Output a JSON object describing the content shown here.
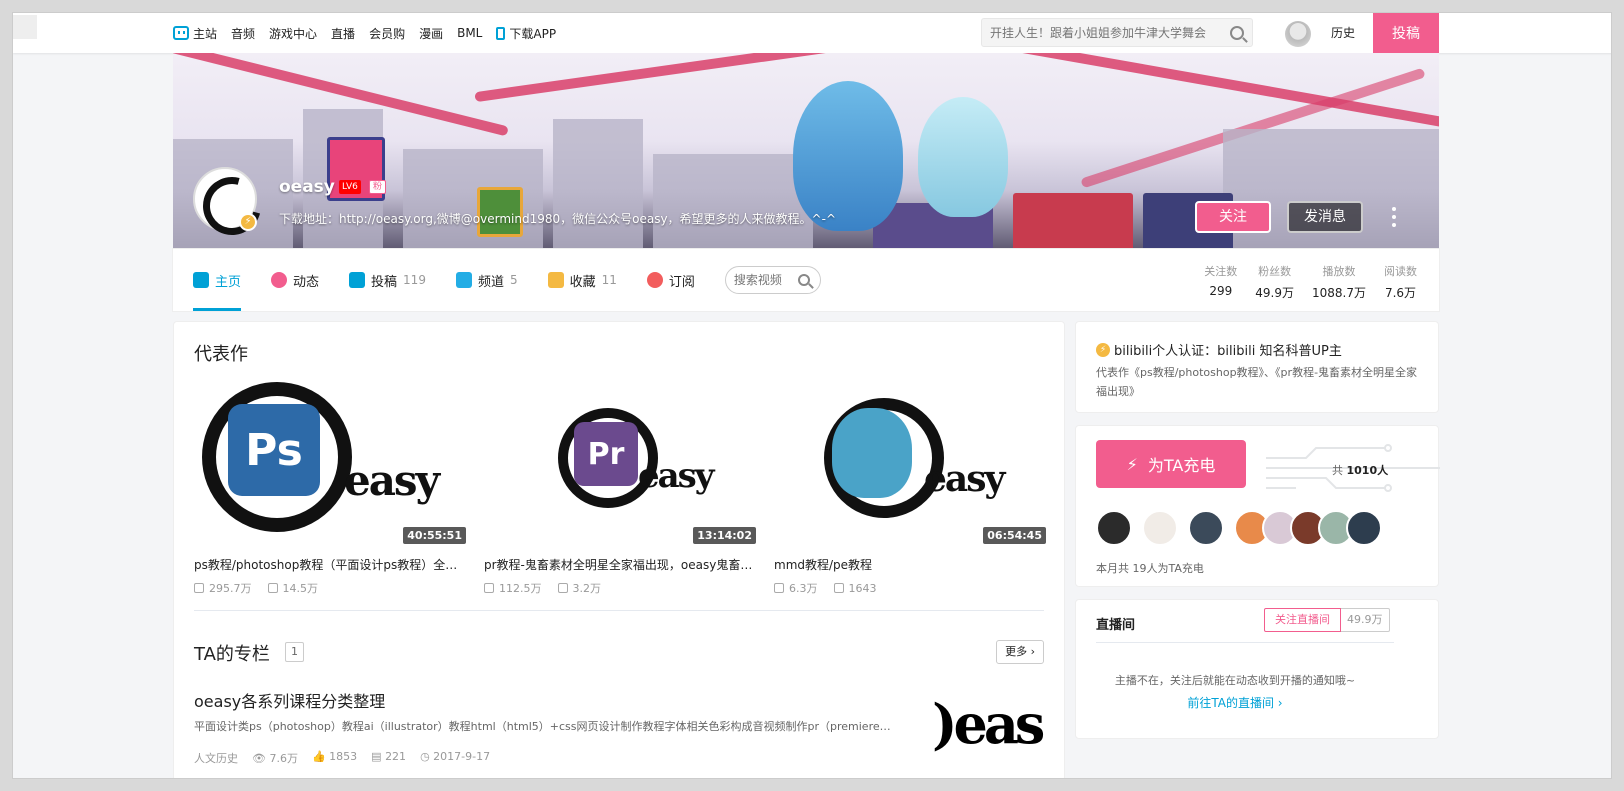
{
  "topnav": {
    "items": [
      {
        "icon": "tv-icon",
        "label": "主站"
      },
      {
        "label": "音频"
      },
      {
        "label": "游戏中心"
      },
      {
        "label": "直播"
      },
      {
        "label": "会员购"
      },
      {
        "label": "漫画"
      },
      {
        "label": "BML"
      },
      {
        "icon": "phone-icon",
        "label": "下载APP"
      }
    ],
    "search_placeholder": "开挂人生！跟着小姐姐参加牛津大学舞会",
    "history": "历史",
    "upload": "投稿"
  },
  "profile": {
    "name": "oeasy",
    "level": "LV6",
    "fan_tag": "粉",
    "sign": "下载地址：http://oeasy.org,微博@overmind1980，微信公众号oeasy，希望更多的人来做教程。^-^",
    "follow": "关注",
    "message": "发消息"
  },
  "tabs": [
    {
      "label": "主页",
      "count": "",
      "icon_color": "#00a1d6",
      "active": true
    },
    {
      "label": "动态",
      "count": "",
      "icon_color": "#f25d8e"
    },
    {
      "label": "投稿",
      "count": "119",
      "icon_color": "#00a1d6"
    },
    {
      "label": "频道",
      "count": "5",
      "icon_color": "#23ade5"
    },
    {
      "label": "收藏",
      "count": "11",
      "icon_color": "#f4b942"
    },
    {
      "label": "订阅",
      "count": "",
      "icon_color": "#f25d5d"
    }
  ],
  "tab_search_placeholder": "搜索视频",
  "stats": [
    {
      "k": "关注数",
      "v": "299"
    },
    {
      "k": "粉丝数",
      "v": "49.9万"
    },
    {
      "k": "播放数",
      "v": "1088.7万"
    },
    {
      "k": "阅读数",
      "v": "7.6万"
    }
  ],
  "masterpiece": {
    "title": "代表作",
    "videos": [
      {
        "title": "ps教程/photoshop教程（平面设计ps教程）全套免",
        "duration": "40:55:51",
        "plays": "295.7万",
        "danmaku": "14.5万",
        "logo": "Ps",
        "logo_color": "#2d6aa8"
      },
      {
        "title": "pr教程-鬼畜素材全明星全家福出现，oeasy鬼畜向 pr",
        "duration": "13:14:02",
        "plays": "112.5万",
        "danmaku": "3.2万",
        "logo": "Pr",
        "logo_color": "#6b4a8e"
      },
      {
        "title": "mmd教程/pe教程",
        "duration": "06:54:45",
        "plays": "6.3万",
        "danmaku": "1643",
        "logo": "",
        "logo_color": "#4aa3c8"
      }
    ]
  },
  "column": {
    "title": "TA的专栏",
    "count": "1",
    "more": "更多",
    "article_title": "oeasy各系列课程分类整理",
    "article_desc": "平面设计类ps（photoshop）教程ai（illustrator）教程html（html5）+css网页设计制作教程字体相关色彩构成音视频制作pr（premiere…",
    "category": "人文历史",
    "views": "7.6万",
    "likes": "1853",
    "comments": "221",
    "date": "2017-9-17"
  },
  "cert": {
    "title": "bilibili个人认证：bilibili 知名科普UP主",
    "desc": "代表作《ps教程/photoshop教程》、《pr教程-鬼畜素材全明星全家福出现》"
  },
  "charge": {
    "button": "为TA充电",
    "total_prefix": "共",
    "total": "1010人",
    "note": "本月共 19人为TA充电"
  },
  "live": {
    "title": "直播间",
    "follow": "关注直播间",
    "count": "49.9万",
    "note": "主播不在，关注后就能在动态收到开播的通知哦~",
    "link": "前往TA的直播间"
  },
  "colors": {
    "accent": "#00a1d6",
    "pink": "#f25d8e"
  }
}
